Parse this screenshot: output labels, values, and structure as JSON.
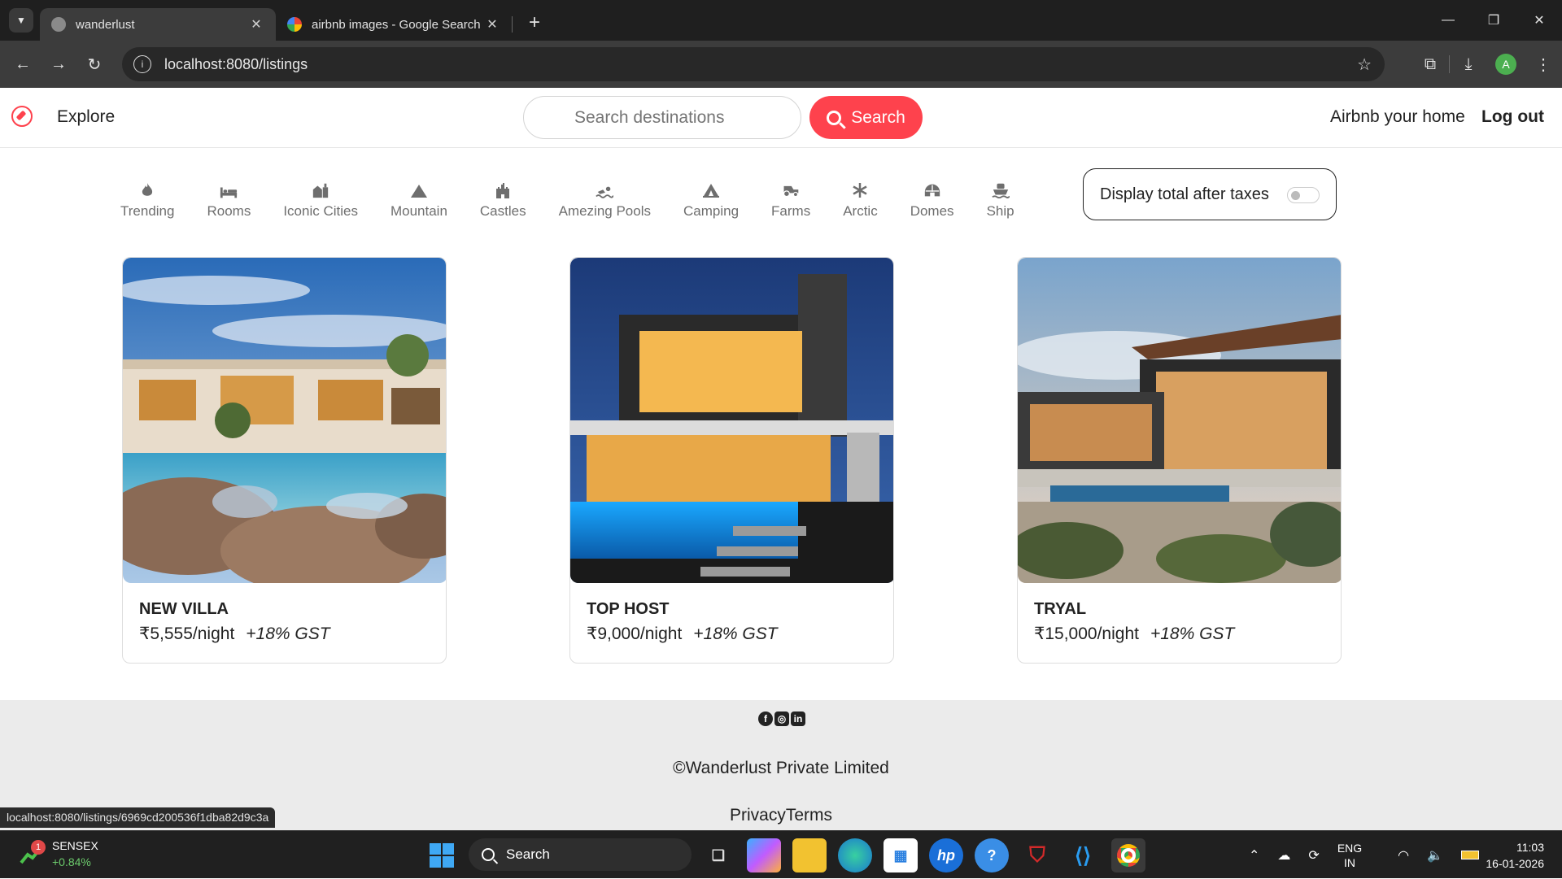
{
  "browser": {
    "tabs": [
      {
        "title": "wanderlust"
      },
      {
        "title": "airbnb images - Google Search"
      }
    ],
    "url": "localhost:8080/listings",
    "profile_initial": "A"
  },
  "navbar": {
    "brand": "Explore",
    "search_placeholder": "Search destinations",
    "search_button": "Search",
    "host_link": "Airbnb your home",
    "logout": "Log out",
    "accent_color": "#fe424d"
  },
  "filters": [
    {
      "label": "Trending",
      "icon": "fire-icon"
    },
    {
      "label": "Rooms",
      "icon": "bed-icon"
    },
    {
      "label": "Iconic Cities",
      "icon": "city-icon"
    },
    {
      "label": "Mountain",
      "icon": "mountain-icon"
    },
    {
      "label": "Castles",
      "icon": "castle-icon"
    },
    {
      "label": "Amezing Pools",
      "icon": "pool-icon"
    },
    {
      "label": "Camping",
      "icon": "campground-icon"
    },
    {
      "label": "Farms",
      "icon": "tractor-icon"
    },
    {
      "label": "Arctic",
      "icon": "snowflake-icon"
    },
    {
      "label": "Domes",
      "icon": "dome-icon"
    },
    {
      "label": "Ship",
      "icon": "ship-icon"
    }
  ],
  "tax_toggle": {
    "label": "Display total after taxes",
    "on": false
  },
  "listings": [
    {
      "name": "NEW VILLA",
      "price": "₹5,555/night",
      "tax": "+18% GST"
    },
    {
      "name": "TOP HOST",
      "price": "₹9,000/night",
      "tax": "+18% GST"
    },
    {
      "name": "TRYAL",
      "price": "₹15,000/night",
      "tax": "+18% GST"
    }
  ],
  "footer": {
    "copyright": "©Wanderlust Private Limited",
    "links": "PrivacyTerms"
  },
  "status_url": "localhost:8080/listings/6969cd200536f1dba82d9c3a",
  "taskbar": {
    "stock_name": "SENSEX",
    "stock_change": "+0.84%",
    "stock_badge": "1",
    "search": "Search",
    "lang_1": "ENG",
    "lang_2": "IN",
    "time": "11:03",
    "date": "16-01-2026"
  }
}
